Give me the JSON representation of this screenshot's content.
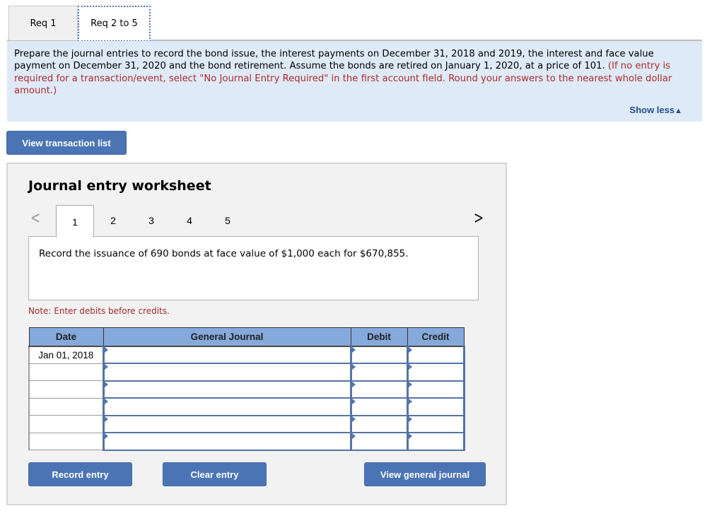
{
  "req_tabs": [
    {
      "label": "Req 1",
      "active": false
    },
    {
      "label": "Req 2 to 5",
      "active": true
    }
  ],
  "instructions": {
    "text_black": "Prepare the journal entries to record the bond issue, the interest payments on December 31, 2018 and 2019,  the interest and face value payment on December 31, 2020 and the bond retirement. Assume the bonds are retired on January 1, 2020, at a price of 101. ",
    "text_red": "(If no entry is required for a transaction/event, select \"No Journal Entry Required\" in the first account field. Round your answers to the nearest whole dollar amount.)",
    "show_less_label": "Show less",
    "show_less_icon": "▲"
  },
  "view_transaction_list_label": "View transaction list",
  "worksheet": {
    "title": "Journal entry worksheet",
    "prev_icon": "<",
    "next_icon": ">",
    "steps": [
      "1",
      "2",
      "3",
      "4",
      "5"
    ],
    "active_step": "1",
    "description": "Record the issuance of 690 bonds at face value of $1,000 each for $670,855.",
    "note": "Note: Enter debits before credits.",
    "table": {
      "headers": {
        "date": "Date",
        "account": "General Journal",
        "debit": "Debit",
        "credit": "Credit"
      },
      "rows": [
        {
          "date": "Jan 01, 2018",
          "account": "",
          "debit": "",
          "credit": ""
        },
        {
          "date": "",
          "account": "",
          "debit": "",
          "credit": ""
        },
        {
          "date": "",
          "account": "",
          "debit": "",
          "credit": ""
        },
        {
          "date": "",
          "account": "",
          "debit": "",
          "credit": ""
        },
        {
          "date": "",
          "account": "",
          "debit": "",
          "credit": ""
        },
        {
          "date": "",
          "account": "",
          "debit": "",
          "credit": ""
        }
      ]
    },
    "buttons": {
      "record_entry": "Record entry",
      "clear_entry": "Clear entry",
      "view_general_journal": "View general journal"
    }
  },
  "colors": {
    "accent_button": "#4b74b4",
    "instruction_bg": "#deeaf7",
    "instruction_red": "#b02a2a",
    "table_header_bg": "#86a9db"
  }
}
